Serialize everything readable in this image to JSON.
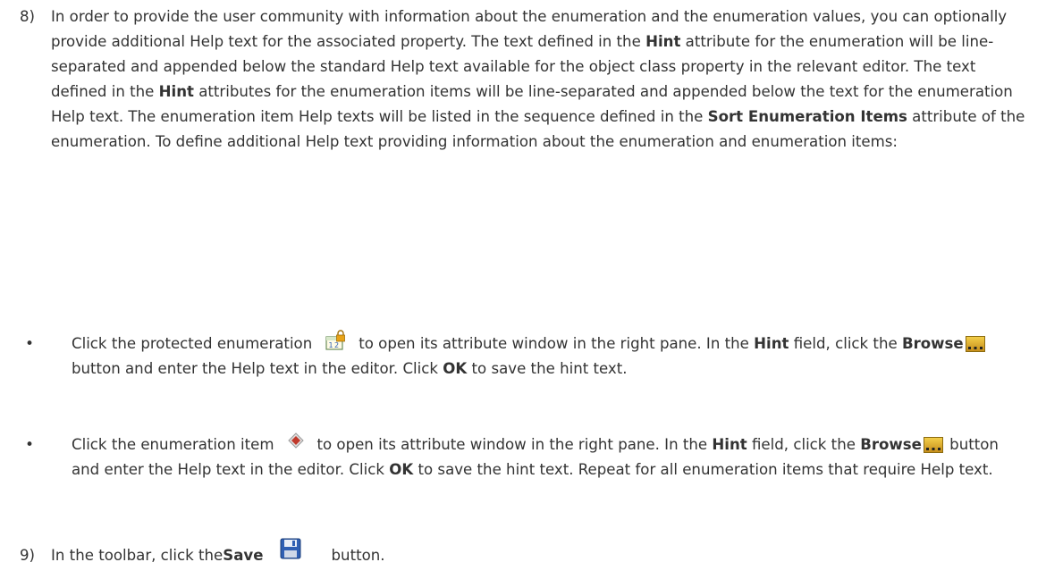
{
  "step8": {
    "num": "8)",
    "text_1": "In order to provide the user community with information about the enumeration and the enumeration values, you can optionally provide additional Help text for the associated property. The text defined in the ",
    "hint_1": "Hint",
    "text_2": " attribute for the enumeration will be line-separated and appended below the standard Help text available for the object class property in the relevant editor. The text defined in the ",
    "hint_2": "Hint",
    "text_3": " attributes for the enumeration items will be line-separated and appended below the text for the enumeration Help text. The enumeration item Help texts will be listed in the sequence defined in the ",
    "sort_items": "Sort Enumeration Items",
    "text_4": " attribute of the enumeration. To define additional Help text providing information about the enumeration and enumeration items:"
  },
  "bullets": [
    {
      "dot": "•",
      "text_1": "Click the protected enumeration",
      "text_2": "to open its attribute window in the right pane. In the ",
      "hint": "Hint",
      "text_3": " field, click the ",
      "browse": "Browse",
      "text_4": " button and enter the Help text in the editor. Click ",
      "ok": "OK",
      "text_5": " to save the hint text."
    },
    {
      "dot": "•",
      "text_1": "Click the enumeration item",
      "text_2": "to open its attribute window in the right pane. In the ",
      "hint": "Hint",
      "text_3": " field, click the ",
      "browse": "Browse",
      "text_4": " button and enter the Help text in the editor. Click ",
      "ok": "OK",
      "text_5": " to save the hint text. Repeat for all enumeration items that require Help text."
    }
  ],
  "step9": {
    "num": "9)",
    "text_1": "In the toolbar, click the ",
    "save": "Save",
    "text_2": "button."
  },
  "icons": {
    "enumeration": "protected-enumeration-icon",
    "enumeration_item": "enumeration-item-icon",
    "browse": "browse-icon",
    "save": "save-icon"
  },
  "colors": {
    "text": "#333333",
    "lock": "#e8a317",
    "diamond": "#c0392b",
    "save_blue": "#2f5fb3"
  }
}
